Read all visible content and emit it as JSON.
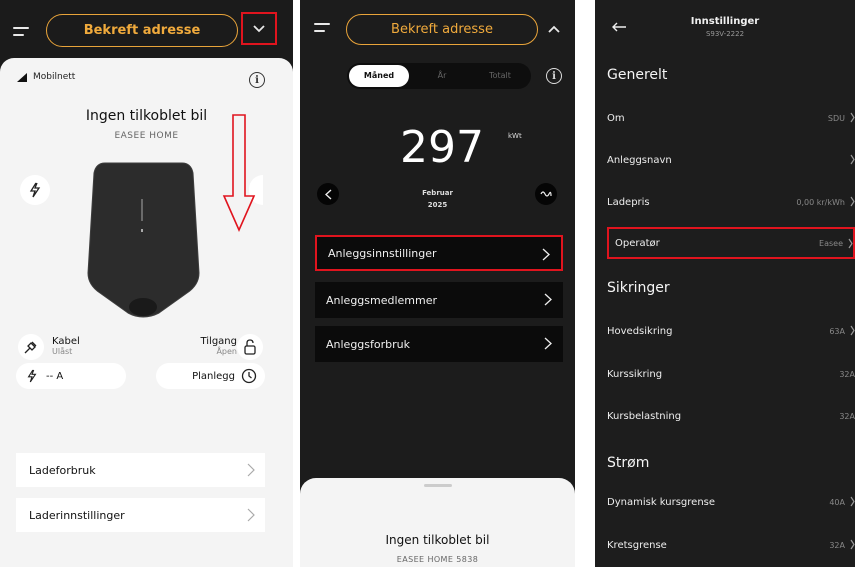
{
  "screen1": {
    "confirm_address": "Bekreft adresse",
    "network_label": "Mobilnett",
    "title": "Ingen tilkoblet bil",
    "subtitle": "EASEE HOME",
    "cable_label": "Kabel",
    "cable_status": "Ulåst",
    "access_label": "Tilgang",
    "access_status": "Åpen",
    "current_value": "-- A",
    "schedule_label": "Planlegg",
    "menu": [
      {
        "label": "Ladeforbruk"
      },
      {
        "label": "Laderinnstillinger"
      }
    ],
    "annotation_color": "#e0141e"
  },
  "screen2": {
    "confirm_address": "Bekreft adresse",
    "tabs": [
      "Måned",
      "År",
      "Totalt"
    ],
    "energy_value": "297",
    "energy_unit": "kWt",
    "month": "Februar",
    "year": "2025",
    "menu": [
      {
        "label": "Anleggsinnstillinger"
      },
      {
        "label": "Anleggsmedlemmer"
      },
      {
        "label": "Anleggsforbruk"
      }
    ],
    "sheet_title": "Ingen tilkoblet bil",
    "sheet_subtitle": "EASEE HOME 5838"
  },
  "screen3": {
    "title": "Innstillinger",
    "subtitle": "S93V-2222",
    "sections": [
      {
        "heading": "Generelt"
      },
      {
        "heading": "Sikringer"
      },
      {
        "heading": "Strøm"
      }
    ],
    "rows": [
      {
        "label": "Om",
        "value": "SDU"
      },
      {
        "label": "Anleggsnavn",
        "value": ""
      },
      {
        "label": "Ladepris",
        "value": "0,00 kr/kWh"
      },
      {
        "label": "Operatør",
        "value": "Easee"
      },
      {
        "label": "Hovedsikring",
        "value": "63A"
      },
      {
        "label": "Kurssikring",
        "value": "32A"
      },
      {
        "label": "Kursbelastning",
        "value": "32A"
      },
      {
        "label": "Dynamisk kursgrense",
        "value": "40A"
      },
      {
        "label": "Kretsgrense",
        "value": "32A"
      }
    ]
  },
  "colors": {
    "accent": "#f0aa3c",
    "dark_bg": "#1c1c1c",
    "highlight": "#e0141e"
  }
}
